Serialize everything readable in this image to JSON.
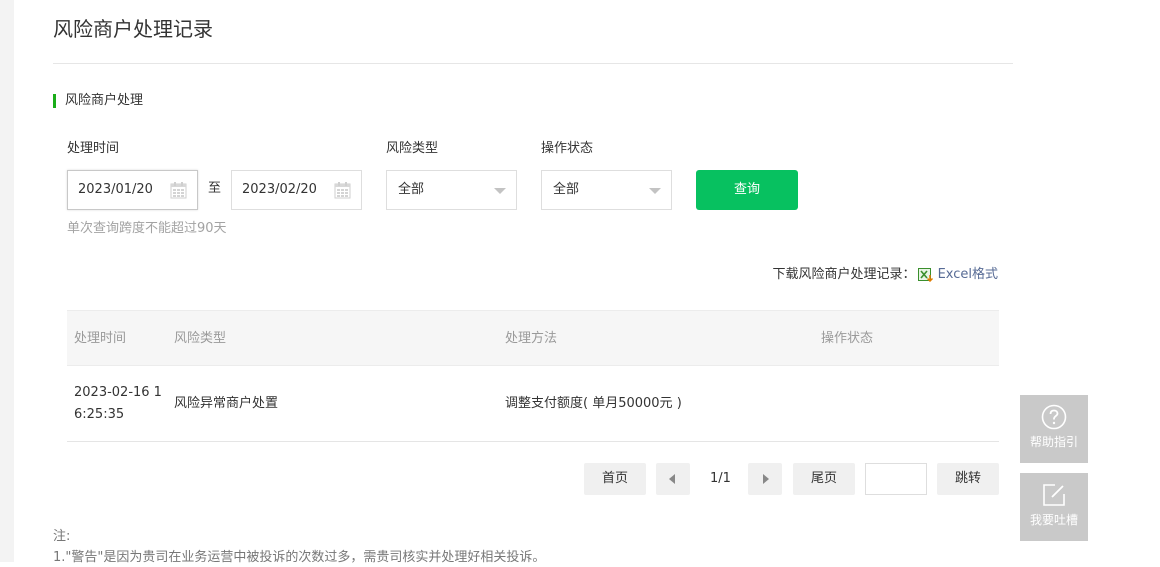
{
  "page": {
    "title": "风险商户处理记录"
  },
  "section": {
    "title": "风险商户处理"
  },
  "filters": {
    "time_label": "处理时间",
    "start_date": "2023/01/20",
    "range_separator": "至",
    "end_date": "2023/02/20",
    "risk_type_label": "风险类型",
    "risk_type_value": "全部",
    "status_label": "操作状态",
    "status_value": "全部",
    "query_button": "查询",
    "hint": "单次查询跨度不能超过90天"
  },
  "download": {
    "label": "下载风险商户处理记录：",
    "link": "Excel格式"
  },
  "table": {
    "columns": [
      "处理时间",
      "风险类型",
      "处理方法",
      "操作状态"
    ],
    "rows": [
      {
        "time_line1": "2023-02-16 1",
        "time_line2": "6:25:35",
        "risk_type": "风险异常商户处置",
        "method": "调整支付额度( 单月50000元 )",
        "status": ""
      }
    ]
  },
  "pagination": {
    "first": "首页",
    "page_count": "1/1",
    "last": "尾页",
    "jump_value": "",
    "jump": "跳转"
  },
  "notes": {
    "title": "注:",
    "line1": "1.\"警告\"是因为贵司在业务运营中被投诉的次数过多，需贵司核实并处理好相关投诉。"
  },
  "float_buttons": {
    "help": "帮助指引",
    "feedback": "我要吐槽"
  },
  "colors": {
    "accent": "#07c160",
    "section_bar": "#1aad19",
    "link": "#576b95",
    "float_bg": "#c9c9c9"
  }
}
